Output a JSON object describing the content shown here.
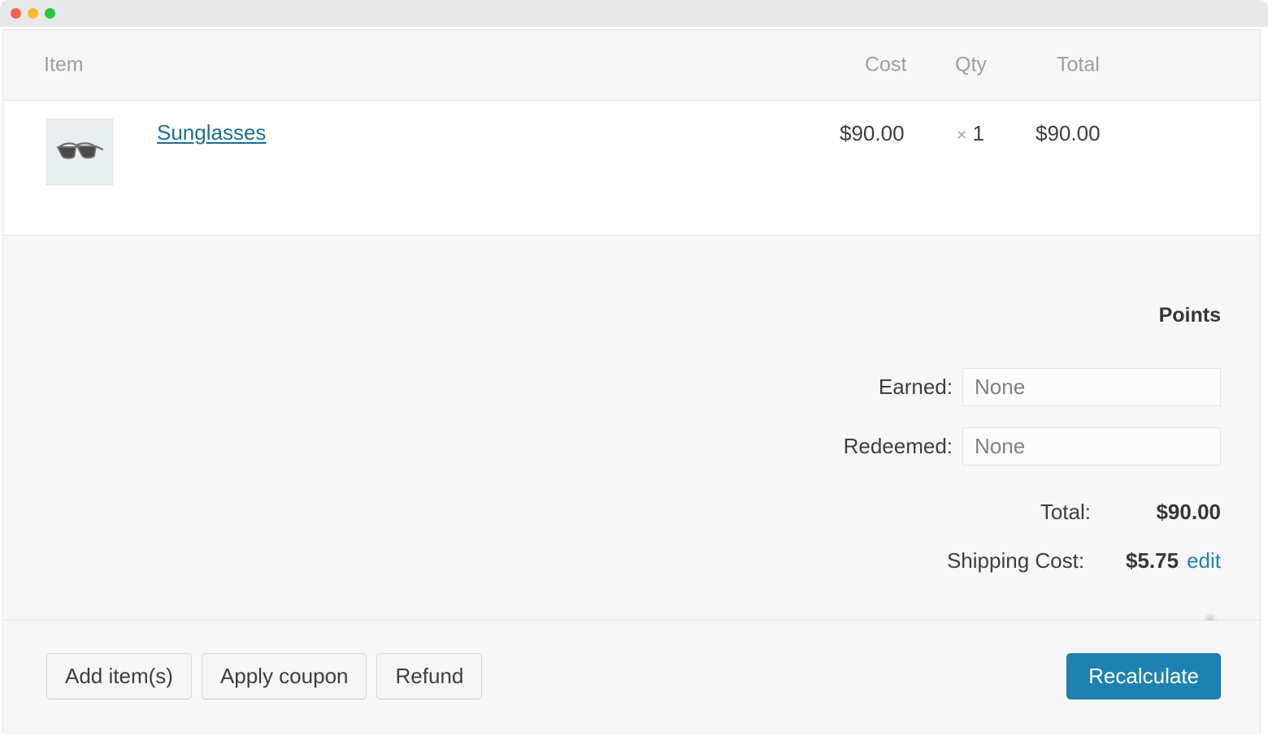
{
  "window": {
    "traffic_lights": [
      "close",
      "minimize",
      "maximize"
    ]
  },
  "items_table": {
    "columns": {
      "item": "Item",
      "cost": "Cost",
      "qty": "Qty",
      "total": "Total"
    },
    "rows": [
      {
        "thumbnail_icon": "sunglasses-product-thumbnail",
        "name": "Sunglasses",
        "cost": "$90.00",
        "qty_separator": "×",
        "qty": "1",
        "line_total": "$90.00"
      }
    ]
  },
  "totals_panel": {
    "points_heading": "Points",
    "fields": [
      {
        "label": "Earned:",
        "value": "None"
      },
      {
        "label": "Redeemed:",
        "value": "None"
      }
    ],
    "lines": [
      {
        "label": "Total:",
        "value": "$90.00"
      },
      {
        "label": "Shipping Cost:",
        "value": "$5.75",
        "action": "edit"
      }
    ]
  },
  "footer": {
    "buttons": [
      "Add item(s)",
      "Apply coupon",
      "Refund"
    ],
    "primary_button": "Recalculate"
  },
  "colors": {
    "accent_blue": "#1d82b0",
    "link_blue": "#1d6f96",
    "panel_bg": "#f7f7f7",
    "row_bg": "#ffffff",
    "muted_text": "#9aa0a6"
  }
}
